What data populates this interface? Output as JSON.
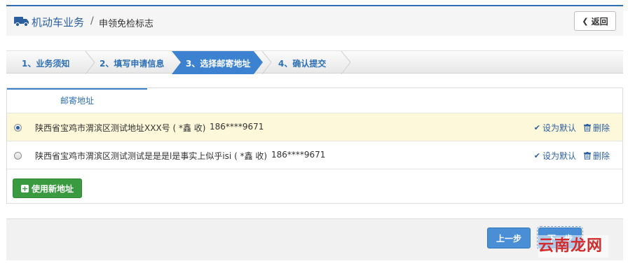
{
  "header": {
    "app_title": "机动车业务",
    "separator": "/",
    "page_title": "申领免检标志",
    "back_label": "返回"
  },
  "steps": [
    {
      "label": "1、业务须知",
      "active": false
    },
    {
      "label": "2、填写申请信息",
      "active": false
    },
    {
      "label": "3、选择邮寄地址",
      "active": true
    },
    {
      "label": "4、确认提交",
      "active": false
    }
  ],
  "panel": {
    "tab_label": "邮寄地址",
    "addresses": [
      {
        "address": "陕西省宝鸡市渭滨区测试地址XXX号 ( *鑫 收)",
        "phone": "186****9671",
        "selected": true
      },
      {
        "address": "陕西省宝鸡市渭滨区测试测试是是是l是事实上似乎isi ( *鑫 收)",
        "phone": "186****9671",
        "selected": false
      }
    ],
    "set_default_label": "设为默认",
    "delete_label": "删除",
    "new_address_label": "使用新地址"
  },
  "footer": {
    "prev_label": "上一步",
    "next_label": "下一步"
  },
  "watermark": "云南龙网",
  "colors": {
    "primary": "#2d6fb5",
    "active_step": "#3d82d0",
    "green": "#3a9a3f",
    "selected_row": "#fcf8d9"
  }
}
